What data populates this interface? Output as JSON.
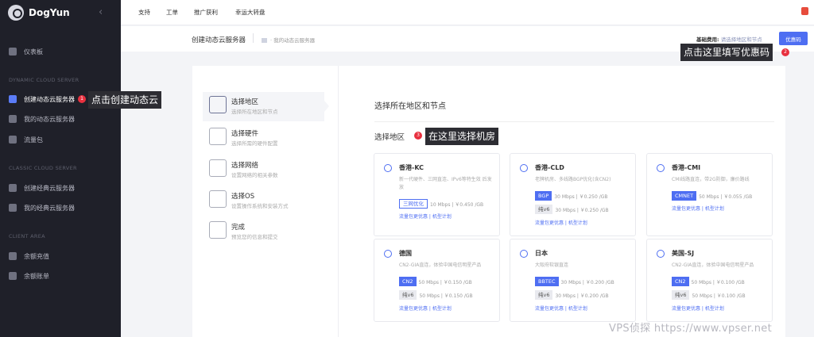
{
  "brand": {
    "name": "DogYun"
  },
  "colors": {
    "accent": "#4e6ef2",
    "sidebar_bg": "#1f2029",
    "alert": "#e8303f"
  },
  "sidebar": {
    "items": [
      {
        "label": "仪表板",
        "icon": "dashboard-icon"
      },
      {
        "label": "创建动态云服务器",
        "icon": "server-stack-icon"
      },
      {
        "label": "我的动态云服务器",
        "icon": "server-icon"
      },
      {
        "label": "流量包",
        "icon": "traffic-icon"
      },
      {
        "label": "创建经典云服务器",
        "icon": "cloud-server-icon"
      },
      {
        "label": "我的经典云服务器",
        "icon": "cloud-icon"
      },
      {
        "label": "余额充值",
        "icon": "yen-icon"
      },
      {
        "label": "余额账单",
        "icon": "bill-icon"
      }
    ],
    "sections": [
      "DYNAMIC CLOUD SERVER",
      "CLASSIC CLOUD SERVER",
      "CLIENT AREA"
    ]
  },
  "topnav": [
    "支持",
    "工单",
    "推广获利",
    "幸运大转盘"
  ],
  "header": {
    "page_title": "创建动态云服务器",
    "breadcrumb": "我的动态云服务器",
    "fee_label": "基础费用:",
    "fee_value": "请选择地区和节点",
    "coupon_button": "优惠码"
  },
  "annotations": {
    "a1": {
      "num": "1",
      "text": "点击创建动态云"
    },
    "a2": {
      "num": "2",
      "text": "点击这里填写优惠码"
    },
    "a3": {
      "num": "3",
      "text": "在这里选择机房"
    }
  },
  "steps": [
    {
      "title": "选择地区",
      "desc": "选择所在地区和节点",
      "icon": "region-icon"
    },
    {
      "title": "选择硬件",
      "desc": "选择所需的硬件配置",
      "icon": "hardware-icon"
    },
    {
      "title": "选择网络",
      "desc": "设置网络的相关参数",
      "icon": "network-icon"
    },
    {
      "title": "选择OS",
      "desc": "设置操作系统和安装方式",
      "icon": "os-icon"
    },
    {
      "title": "完成",
      "desc": "预览您的信息和提交",
      "icon": "done-icon"
    }
  ],
  "main": {
    "section_title": "选择所在地区和节点",
    "region_label": "选择地区",
    "regions": [
      {
        "name": "香港-KC",
        "desc": "新一代硬件、三网直连、IPv6等特生效 后发放",
        "lines": [
          {
            "tag": "三网优化",
            "style": "outline",
            "text": "10 Mbps | ￥0.450 /GB"
          }
        ],
        "links": "流量包更优惠 | 机型计划"
      },
      {
        "name": "香港-CLD",
        "desc": "老牌机房、多线路BGP优化(含CN2)",
        "lines": [
          {
            "tag": "BGP",
            "style": "blue",
            "text": "30 Mbps | ￥0.250 /GB"
          },
          {
            "tag": "纯v6",
            "style": "gray",
            "text": "30 Mbps | ￥0.250 /GB"
          }
        ],
        "links": "流量包更优惠 | 机型计划"
      },
      {
        "name": "香港-CMI",
        "desc": "CMI线路直连，带2G防御，廉价路线",
        "lines": [
          {
            "tag": "CMNET",
            "style": "blue",
            "text": "50 Mbps | ￥0.055 /GB"
          }
        ],
        "links": "流量包更优惠 | 机型计划"
      },
      {
        "name": "德国",
        "desc": "CN2-GIA直连，体验中国电信明星产品",
        "lines": [
          {
            "tag": "CN2",
            "style": "blue",
            "text": "50 Mbps | ￥0.150 /GB"
          },
          {
            "tag": "纯v6",
            "style": "gray",
            "text": "50 Mbps | ￥0.150 /GB"
          }
        ],
        "links": "流量包更优惠 | 机型计划"
      },
      {
        "name": "日本",
        "desc": "大阪府软银直连",
        "lines": [
          {
            "tag": "BBTEC",
            "style": "blue",
            "text": "30 Mbps | ￥0.200 /GB"
          },
          {
            "tag": "纯v6",
            "style": "gray",
            "text": "30 Mbps | ￥0.200 /GB"
          }
        ],
        "links": "流量包更优惠 | 机型计划"
      },
      {
        "name": "美国-SJ",
        "desc": "CN2-GIA直连，体验中国电信明星产品",
        "lines": [
          {
            "tag": "CN2",
            "style": "blue",
            "text": "50 Mbps | ￥0.100 /GB"
          },
          {
            "tag": "纯v6",
            "style": "gray",
            "text": "50 Mbps | ￥0.100 /GB"
          }
        ],
        "links": "流量包更优惠 | 机型计划"
      }
    ]
  },
  "watermark": "VPS侦探 https://www.vpser.net"
}
